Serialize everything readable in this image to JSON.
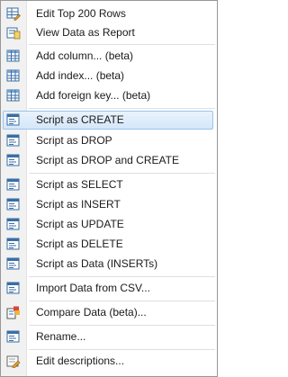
{
  "menu": {
    "items": [
      {
        "label": "Edit Top 200 Rows",
        "icon": "edit-grid-icon"
      },
      {
        "label": "View Data as Report",
        "icon": "report-icon"
      },
      {
        "label": "Add column... (beta)",
        "icon": "table-icon"
      },
      {
        "label": "Add index... (beta)",
        "icon": "table-icon"
      },
      {
        "label": "Add foreign key... (beta)",
        "icon": "table-icon"
      },
      {
        "label": "Script as CREATE",
        "icon": "script-icon",
        "selected": true
      },
      {
        "label": "Script as DROP",
        "icon": "script-icon"
      },
      {
        "label": "Script as DROP and CREATE",
        "icon": "script-icon"
      },
      {
        "label": "Script as SELECT",
        "icon": "script-icon"
      },
      {
        "label": "Script as INSERT",
        "icon": "script-icon"
      },
      {
        "label": "Script as UPDATE",
        "icon": "script-icon"
      },
      {
        "label": "Script as DELETE",
        "icon": "script-icon"
      },
      {
        "label": "Script as Data (INSERTs)",
        "icon": "script-icon"
      },
      {
        "label": "Import Data from CSV...",
        "icon": "script-icon"
      },
      {
        "label": "Compare Data (beta)...",
        "icon": "compare-icon"
      },
      {
        "label": "Rename...",
        "icon": "script-icon"
      },
      {
        "label": "Edit descriptions...",
        "icon": "edit-descriptions-icon"
      }
    ]
  },
  "colors": {
    "selection": "#d4e7fa",
    "selection_border": "#99c3ee",
    "icon_blue": "#3a6ea5"
  }
}
